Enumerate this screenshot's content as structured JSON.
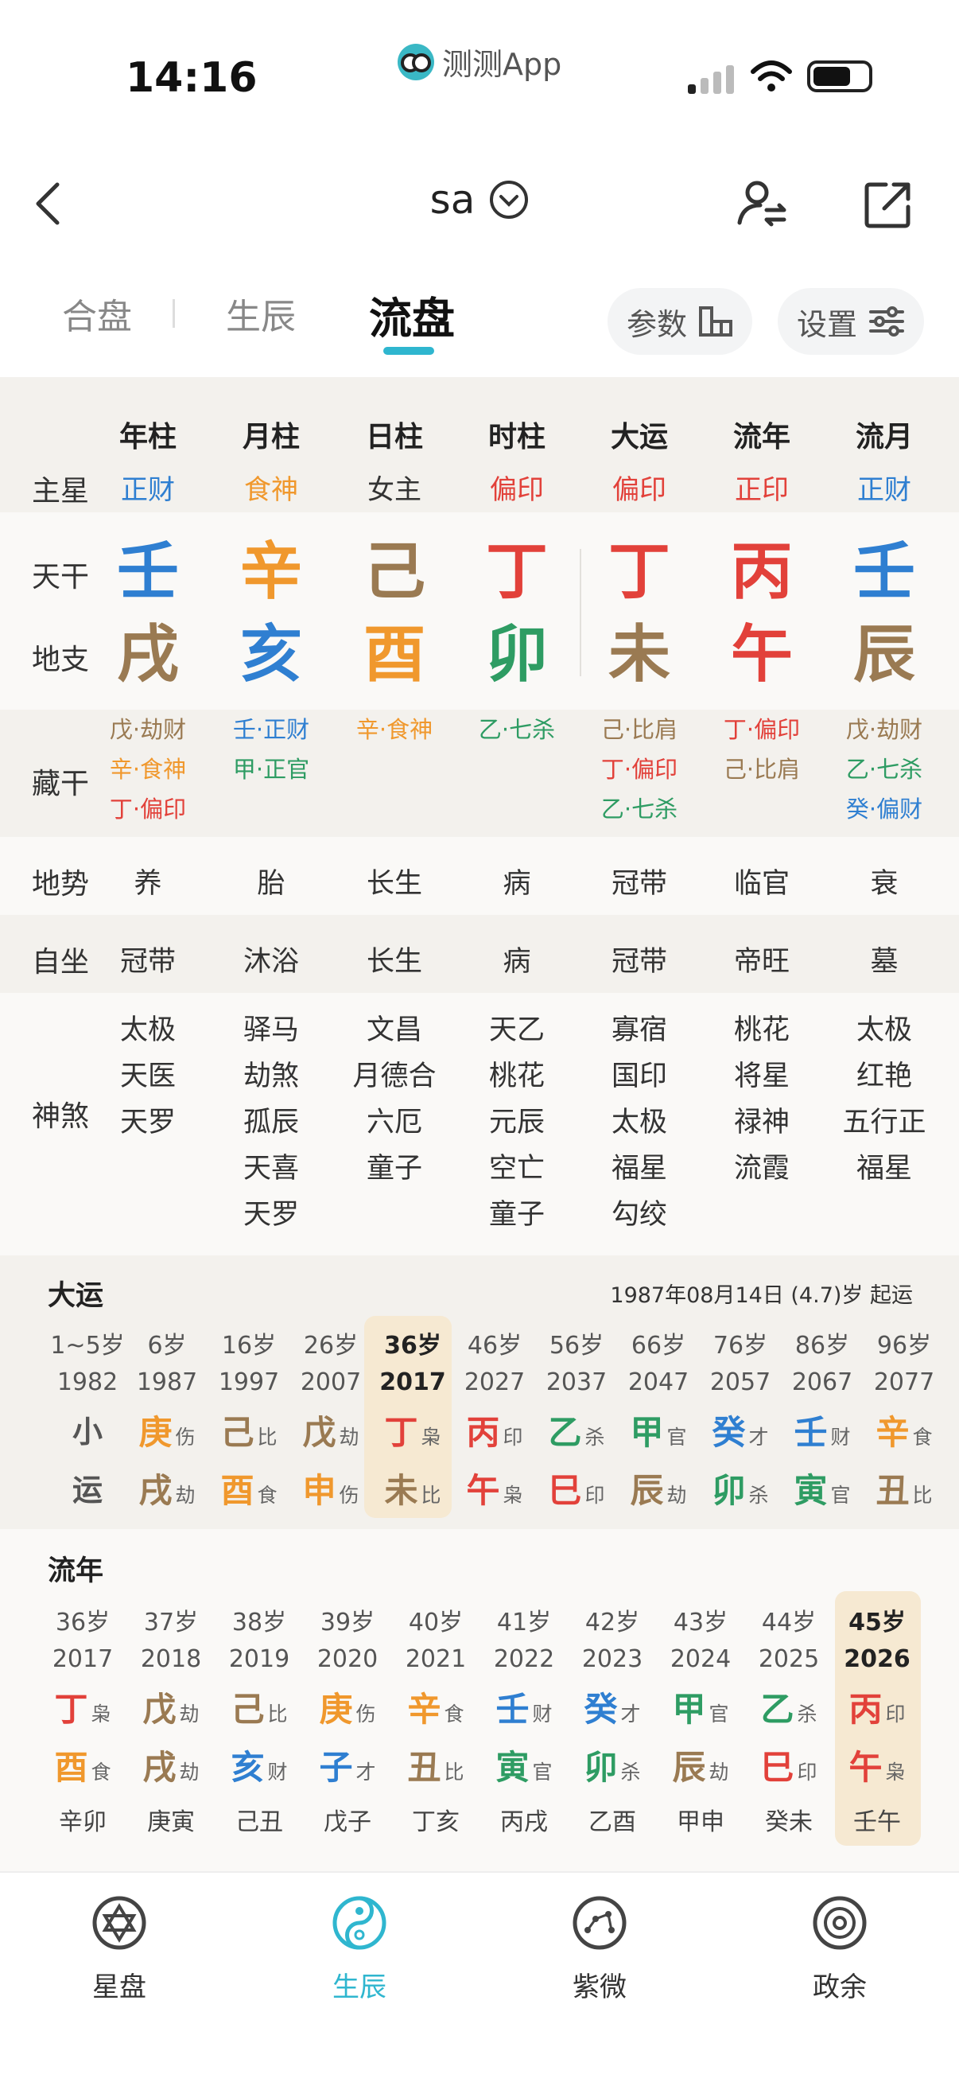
{
  "status": {
    "time": "14:16",
    "app": "测测App"
  },
  "header": {
    "title": "sa"
  },
  "tabs": [
    {
      "label": "合盘"
    },
    {
      "label": "生辰"
    },
    {
      "label": "流盘"
    }
  ],
  "pills": {
    "params": "参数",
    "settings": "设置"
  },
  "colors": {
    "blue": "#2f7fd1",
    "orange": "#f0982d",
    "brown": "#9a7a52",
    "red": "#e2413a",
    "green": "#2e9c63",
    "accent": "#2fb6cf",
    "highlight": "#f6e9d2"
  },
  "chart": {
    "row_labels": {
      "main": "主星",
      "tg": "天干",
      "dz": "地支",
      "hidden": "藏干",
      "dishi": "地势",
      "zizuo": "自坐",
      "shensha": "神煞"
    },
    "columns": [
      {
        "head": "年柱",
        "main": "正财",
        "main_color": "blue",
        "tg": "壬",
        "tg_color": "blue",
        "dz": "戌",
        "dz_color": "brown",
        "hidden": [
          {
            "t": "戊·劫财",
            "c": "brown"
          },
          {
            "t": "辛·食神",
            "c": "orange"
          },
          {
            "t": "丁·偏印",
            "c": "red"
          }
        ],
        "dishi": "养",
        "zizuo": "冠带",
        "shensha": [
          "太极",
          "天医",
          "天罗"
        ]
      },
      {
        "head": "月柱",
        "main": "食神",
        "main_color": "orange",
        "tg": "辛",
        "tg_color": "orange",
        "dz": "亥",
        "dz_color": "blue",
        "hidden": [
          {
            "t": "壬·正财",
            "c": "blue"
          },
          {
            "t": "甲·正官",
            "c": "green"
          }
        ],
        "dishi": "胎",
        "zizuo": "沐浴",
        "shensha": [
          "驿马",
          "劫煞",
          "孤辰",
          "天喜",
          "天罗"
        ]
      },
      {
        "head": "日柱",
        "main": "女主",
        "main_color": "dark",
        "tg": "己",
        "tg_color": "brown",
        "dz": "酉",
        "dz_color": "orange",
        "hidden": [
          {
            "t": "辛·食神",
            "c": "orange"
          }
        ],
        "dishi": "长生",
        "zizuo": "长生",
        "shensha": [
          "文昌",
          "月德合",
          "六厄",
          "童子"
        ]
      },
      {
        "head": "时柱",
        "main": "偏印",
        "main_color": "red",
        "tg": "丁",
        "tg_color": "red",
        "dz": "卯",
        "dz_color": "green",
        "hidden": [
          {
            "t": "乙·七杀",
            "c": "green"
          }
        ],
        "dishi": "病",
        "zizuo": "病",
        "shensha": [
          "天乙",
          "桃花",
          "元辰",
          "空亡",
          "童子"
        ]
      },
      {
        "head": "大运",
        "main": "偏印",
        "main_color": "red",
        "tg": "丁",
        "tg_color": "red",
        "dz": "未",
        "dz_color": "brown",
        "hidden": [
          {
            "t": "己·比肩",
            "c": "brown"
          },
          {
            "t": "丁·偏印",
            "c": "red"
          },
          {
            "t": "乙·七杀",
            "c": "green"
          }
        ],
        "dishi": "冠带",
        "zizuo": "冠带",
        "shensha": [
          "寡宿",
          "国印",
          "太极",
          "福星",
          "勾绞"
        ]
      },
      {
        "head": "流年",
        "main": "正印",
        "main_color": "red",
        "tg": "丙",
        "tg_color": "red",
        "dz": "午",
        "dz_color": "red",
        "hidden": [
          {
            "t": "丁·偏印",
            "c": "red"
          },
          {
            "t": "己·比肩",
            "c": "brown"
          }
        ],
        "dishi": "临官",
        "zizuo": "帝旺",
        "shensha": [
          "桃花",
          "将星",
          "禄神",
          "流霞"
        ]
      },
      {
        "head": "流月",
        "main": "正财",
        "main_color": "blue",
        "tg": "壬",
        "tg_color": "blue",
        "dz": "辰",
        "dz_color": "brown",
        "hidden": [
          {
            "t": "戊·劫财",
            "c": "brown"
          },
          {
            "t": "乙·七杀",
            "c": "green"
          },
          {
            "t": "癸·偏财",
            "c": "blue"
          }
        ],
        "dishi": "衰",
        "zizuo": "墓",
        "shensha": [
          "太极",
          "红艳",
          "五行正",
          "福星"
        ]
      }
    ]
  },
  "dayun": {
    "title": "大运",
    "info": "1987年08月14日 (4.7)岁 起运",
    "xiao": {
      "a": "小",
      "b": "运",
      "age": "1~5岁",
      "year": "1982"
    },
    "items": [
      {
        "age": "6岁",
        "year": "1987",
        "tg": "庚",
        "tgs": "伤",
        "tgc": "orange",
        "dz": "戌",
        "dzs": "劫",
        "dzc": "brown"
      },
      {
        "age": "16岁",
        "year": "1997",
        "tg": "己",
        "tgs": "比",
        "tgc": "brown",
        "dz": "酉",
        "dzs": "食",
        "dzc": "orange"
      },
      {
        "age": "26岁",
        "year": "2007",
        "tg": "戊",
        "tgs": "劫",
        "tgc": "brown",
        "dz": "申",
        "dzs": "伤",
        "dzc": "orange"
      },
      {
        "age": "36岁",
        "year": "2017",
        "tg": "丁",
        "tgs": "枭",
        "tgc": "red",
        "dz": "未",
        "dzs": "比",
        "dzc": "brown",
        "active": true
      },
      {
        "age": "46岁",
        "year": "2027",
        "tg": "丙",
        "tgs": "印",
        "tgc": "red",
        "dz": "午",
        "dzs": "枭",
        "dzc": "red"
      },
      {
        "age": "56岁",
        "year": "2037",
        "tg": "乙",
        "tgs": "杀",
        "tgc": "green",
        "dz": "巳",
        "dzs": "印",
        "dzc": "red"
      },
      {
        "age": "66岁",
        "year": "2047",
        "tg": "甲",
        "tgs": "官",
        "tgc": "green",
        "dz": "辰",
        "dzs": "劫",
        "dzc": "brown"
      },
      {
        "age": "76岁",
        "year": "2057",
        "tg": "癸",
        "tgs": "才",
        "tgc": "blue",
        "dz": "卯",
        "dzs": "杀",
        "dzc": "green"
      },
      {
        "age": "86岁",
        "year": "2067",
        "tg": "壬",
        "tgs": "财",
        "tgc": "blue",
        "dz": "寅",
        "dzs": "官",
        "dzc": "green"
      },
      {
        "age": "96岁",
        "year": "2077",
        "tg": "辛",
        "tgs": "食",
        "tgc": "orange",
        "dz": "丑",
        "dzs": "比",
        "dzc": "brown"
      }
    ]
  },
  "liunian": {
    "title": "流年",
    "items": [
      {
        "age": "36岁",
        "year": "2017",
        "tg": "丁",
        "tgs": "枭",
        "tgc": "red",
        "dz": "酉",
        "dzs": "食",
        "dzc": "orange",
        "month": "辛卯"
      },
      {
        "age": "37岁",
        "year": "2018",
        "tg": "戊",
        "tgs": "劫",
        "tgc": "brown",
        "dz": "戌",
        "dzs": "劫",
        "dzc": "brown",
        "month": "庚寅"
      },
      {
        "age": "38岁",
        "year": "2019",
        "tg": "己",
        "tgs": "比",
        "tgc": "brown",
        "dz": "亥",
        "dzs": "财",
        "dzc": "blue",
        "month": "己丑"
      },
      {
        "age": "39岁",
        "year": "2020",
        "tg": "庚",
        "tgs": "伤",
        "tgc": "orange",
        "dz": "子",
        "dzs": "才",
        "dzc": "blue",
        "month": "戊子"
      },
      {
        "age": "40岁",
        "year": "2021",
        "tg": "辛",
        "tgs": "食",
        "tgc": "orange",
        "dz": "丑",
        "dzs": "比",
        "dzc": "brown",
        "month": "丁亥"
      },
      {
        "age": "41岁",
        "year": "2022",
        "tg": "壬",
        "tgs": "财",
        "tgc": "blue",
        "dz": "寅",
        "dzs": "官",
        "dzc": "green",
        "month": "丙戌"
      },
      {
        "age": "42岁",
        "year": "2023",
        "tg": "癸",
        "tgs": "才",
        "tgc": "blue",
        "dz": "卯",
        "dzs": "杀",
        "dzc": "green",
        "month": "乙酉"
      },
      {
        "age": "43岁",
        "year": "2024",
        "tg": "甲",
        "tgs": "官",
        "tgc": "green",
        "dz": "辰",
        "dzs": "劫",
        "dzc": "brown",
        "month": "甲申"
      },
      {
        "age": "44岁",
        "year": "2025",
        "tg": "乙",
        "tgs": "杀",
        "tgc": "green",
        "dz": "巳",
        "dzs": "印",
        "dzc": "red",
        "month": "癸未"
      },
      {
        "age": "45岁",
        "year": "2026",
        "tg": "丙",
        "tgs": "印",
        "tgc": "red",
        "dz": "午",
        "dzs": "枭",
        "dzc": "red",
        "month": "壬午",
        "active": true
      }
    ]
  },
  "nav": [
    {
      "label": "星盘",
      "icon": "star-of-david-icon"
    },
    {
      "label": "生辰",
      "icon": "yin-yang-icon"
    },
    {
      "label": "紫微",
      "icon": "constellation-icon"
    },
    {
      "label": "政余",
      "icon": "wheel-icon"
    }
  ]
}
